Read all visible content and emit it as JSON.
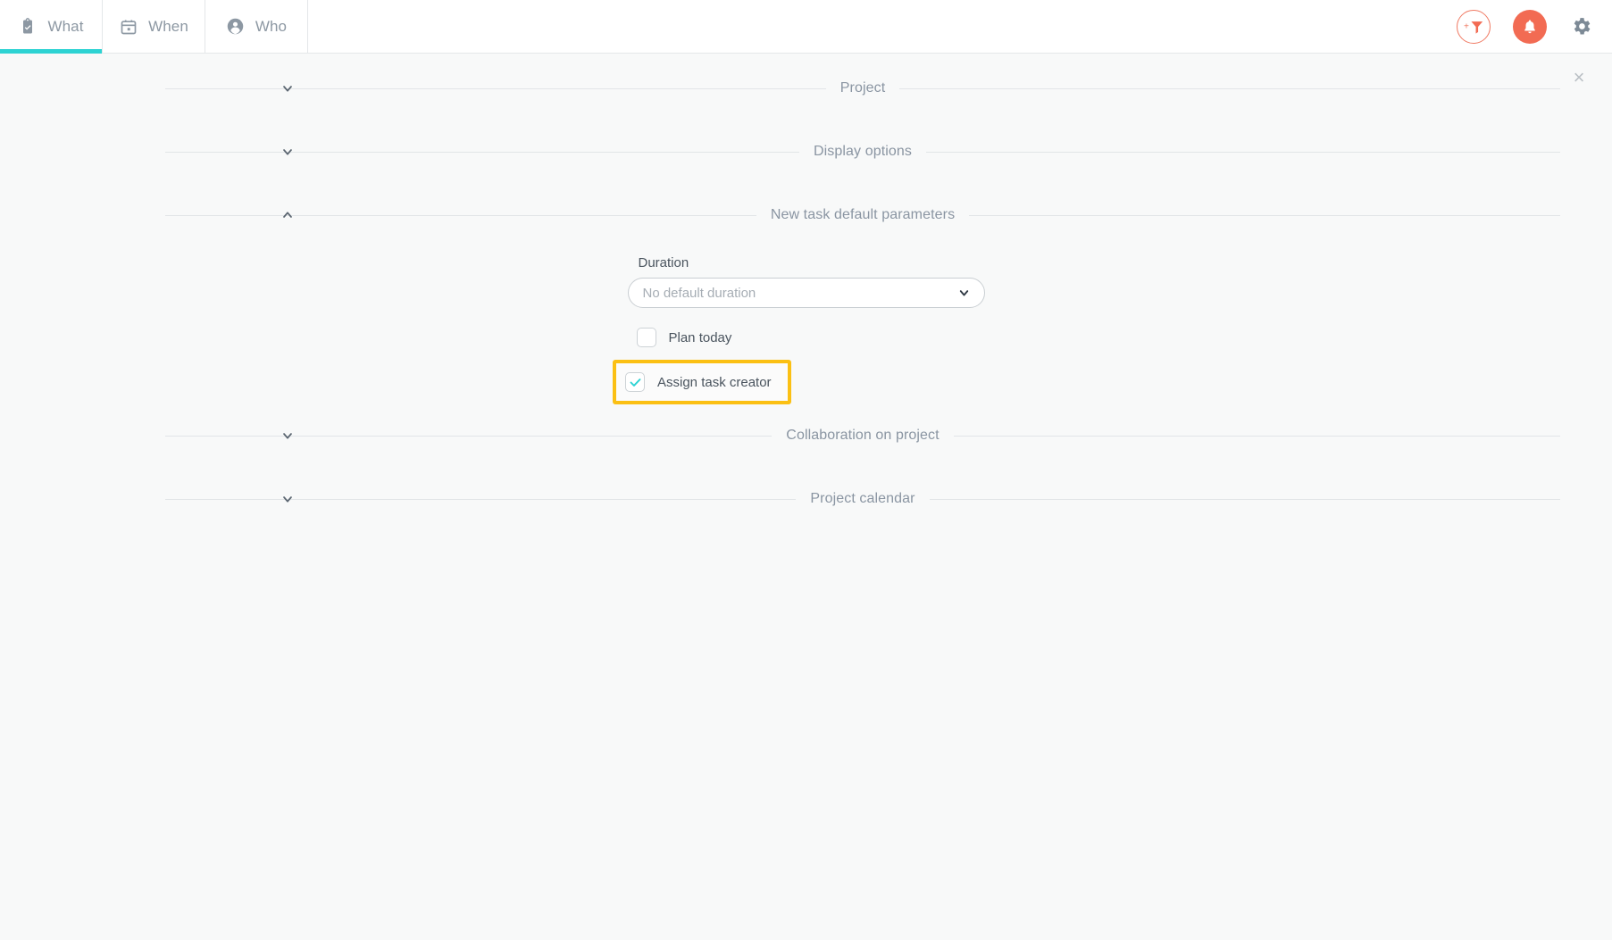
{
  "header": {
    "tabs": [
      {
        "label": "What",
        "icon": "clipboard-check-icon",
        "active": true
      },
      {
        "label": "When",
        "icon": "calendar-icon",
        "active": false
      },
      {
        "label": "Who",
        "icon": "person-icon",
        "active": false
      }
    ],
    "actions": {
      "filter": "add-filter-icon",
      "notifications": "bell-icon",
      "settings": "gear-icon"
    },
    "accent_teal": "#2dd3d3",
    "accent_coral": "#f26b53"
  },
  "panel": {
    "close_label": "×",
    "sections": [
      {
        "title": "Project",
        "expanded": false,
        "chevron": "chevron-down-icon"
      },
      {
        "title": "Display options",
        "expanded": false,
        "chevron": "chevron-down-icon"
      },
      {
        "title": "New task default parameters",
        "expanded": true,
        "chevron": "chevron-up-icon"
      },
      {
        "title": "Collaboration on project",
        "expanded": false,
        "chevron": "chevron-down-icon"
      },
      {
        "title": "Project calendar",
        "expanded": false,
        "chevron": "chevron-down-icon"
      }
    ]
  },
  "new_task_defaults": {
    "duration_label": "Duration",
    "duration_value": "No default duration",
    "duration_chevron": "chevron-down-icon",
    "plan_today": {
      "label": "Plan today",
      "checked": false
    },
    "assign_task_creator": {
      "label": "Assign task creator",
      "checked": true,
      "highlighted": true,
      "highlight_color": "#fbc014"
    }
  }
}
